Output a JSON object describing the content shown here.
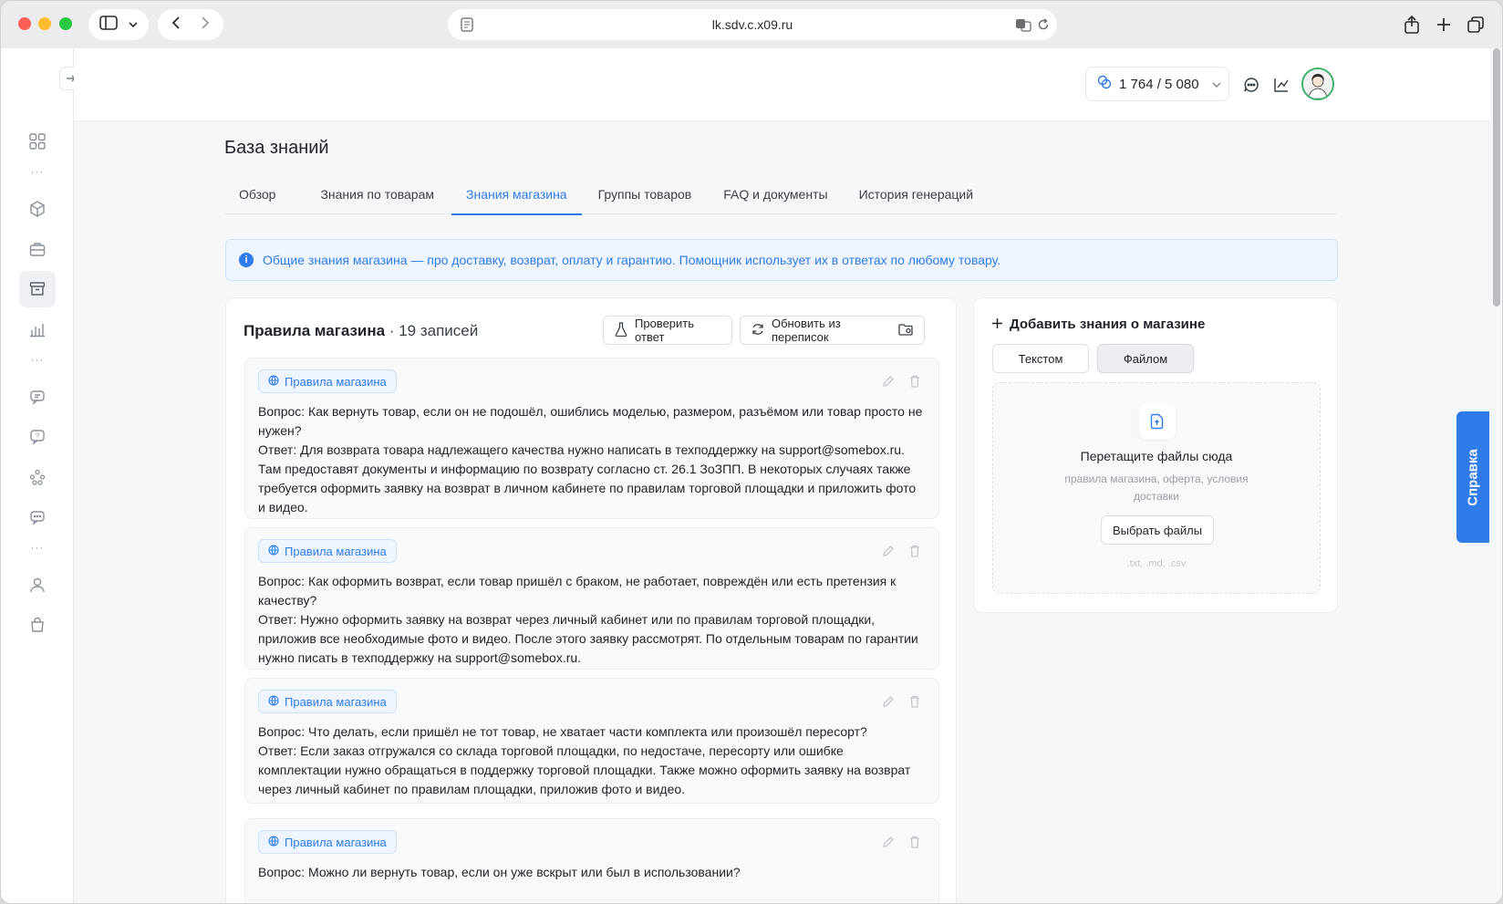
{
  "browser": {
    "url": "lk.sdv.c.x09.ru"
  },
  "topbar": {
    "counter": "1 764 / 5 080"
  },
  "page": {
    "title": "База знаний",
    "tabs": [
      {
        "label": "Обзор"
      },
      {
        "label": "Знания по товарам"
      },
      {
        "label": "Знания магазина"
      },
      {
        "label": "Группы товаров"
      },
      {
        "label": "FAQ и документы"
      },
      {
        "label": "История генераций"
      }
    ],
    "active_tab": "Знания магазина",
    "info": "Общие знания магазина — про доставку, возврат, оплату и гарантию. Помощник использует их в ответах по любому товару."
  },
  "rules": {
    "title": "Правила магазина",
    "count": " · 19 записей",
    "check_button": "Проверить ответ",
    "update_button": "Обновить из переписок",
    "entries": [
      {
        "tag": "Правила магазина",
        "question": "Вопрос: Как вернуть товар, если он не подошёл, ошиблись моделью, размером, разъёмом или товар просто не нужен?",
        "answer": "Ответ: Для возврата товара надлежащего качества нужно написать в техподдержку на support@somebox.ru. Там предоставят документы и информацию по возврату согласно ст. 26.1 ЗоЗПП. В некоторых случаях также требуется оформить заявку на возврат в личном кабинете по правилам торговой площадки и приложить фото и видео."
      },
      {
        "tag": "Правила магазина",
        "question": "Вопрос: Как оформить возврат, если товар пришёл с браком, не работает, повреждён или есть претензия к качеству?",
        "answer": "Ответ: Нужно оформить заявку на возврат через личный кабинет или по правилам торговой площадки, приложив все необходимые фото и видео. После этого заявку рассмотрят. По отдельным товарам по гарантии нужно писать в техподдержку на support@somebox.ru."
      },
      {
        "tag": "Правила магазина",
        "question": "Вопрос: Что делать, если пришёл не тот товар, не хватает части комплекта или произошёл пересорт?",
        "answer": "Ответ: Если заказ отгружался со склада торговой площадки, по недостаче, пересорту или ошибке комплектации нужно обращаться в поддержку торговой площадки. Также можно оформить заявку на возврат через личный кабинет по правилам площадки, приложив фото и видео."
      },
      {
        "tag": "Правила магазина",
        "question": "Вопрос: Можно ли вернуть товар, если он уже вскрыт или был в использовании?",
        "answer": ""
      }
    ]
  },
  "add_panel": {
    "title": "Добавить знания о магазине",
    "tab_text": "Текстом",
    "tab_file": "Файлом",
    "drop_title": "Перетащите файлы сюда",
    "drop_sub": "правила магазина, оферта, условия доставки",
    "choose_button": "Выбрать файлы",
    "extensions": ".txt, .md, .csv"
  },
  "help": {
    "label": "Справка"
  }
}
